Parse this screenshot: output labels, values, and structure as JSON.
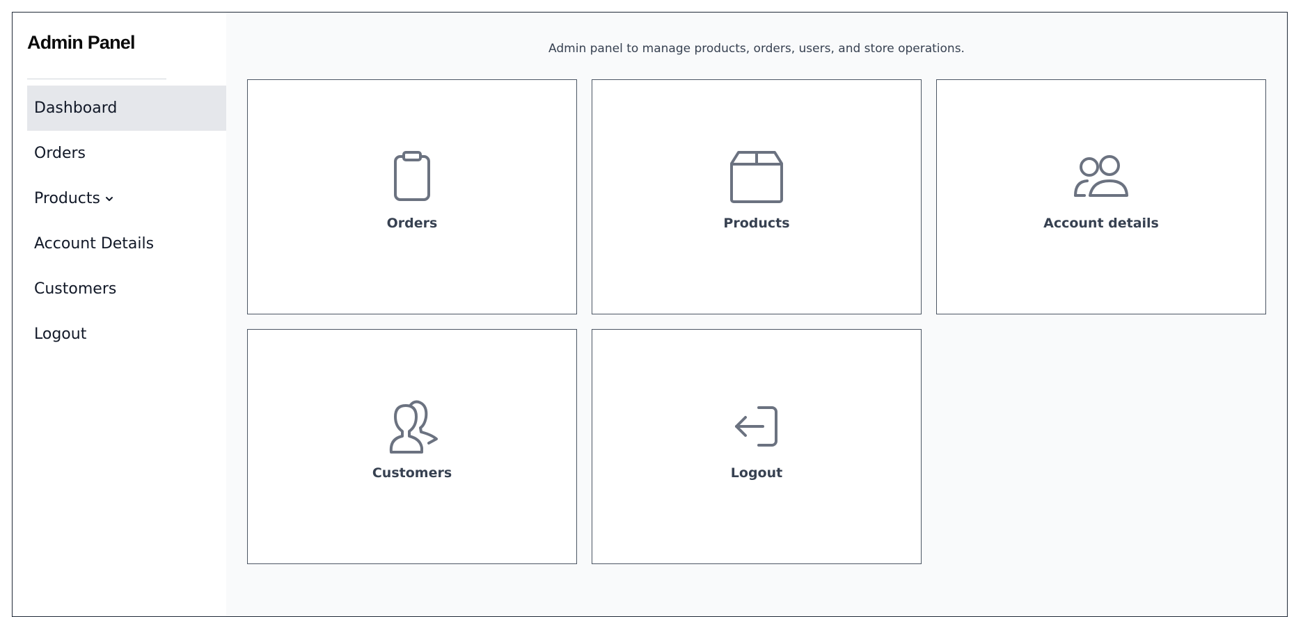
{
  "sidebar": {
    "brand": "Admin Panel",
    "items": [
      {
        "label": "Dashboard",
        "active": true
      },
      {
        "label": "Orders"
      },
      {
        "label": "Products",
        "icon": "chevron-down-icon"
      },
      {
        "label": "Account Details"
      },
      {
        "label": "Customers"
      },
      {
        "label": "Logout"
      }
    ]
  },
  "main": {
    "subtitle": "Admin panel to manage products, orders, users, and store operations.",
    "cards": [
      {
        "label": "Orders",
        "icon": "clipboard-icon"
      },
      {
        "label": "Products",
        "icon": "box-icon"
      },
      {
        "label": "Account details",
        "icon": "users-icon"
      },
      {
        "label": "Customers",
        "icon": "customers-icon"
      },
      {
        "label": "Logout",
        "icon": "logout-icon"
      }
    ]
  },
  "colors": {
    "icon_stroke": "#6b7280",
    "active_nav_bg": "#e5e7eb",
    "main_bg": "#f9fafb",
    "card_border": "#4b5563"
  }
}
